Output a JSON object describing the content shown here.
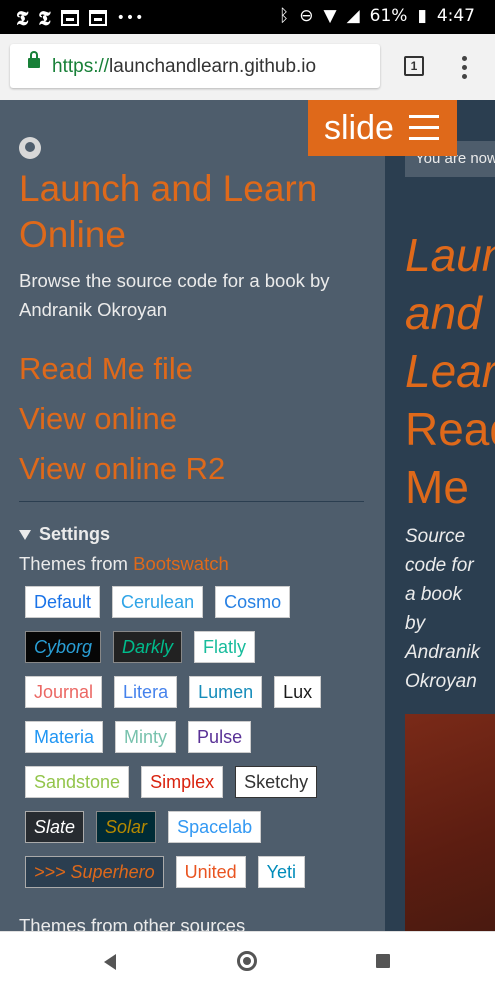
{
  "status_bar": {
    "battery": "61%",
    "time": "4:47"
  },
  "browser": {
    "url_scheme": "https://",
    "url_host": "launchandlearn.github.io",
    "tab_count": "1"
  },
  "slide_button": {
    "label": "slide"
  },
  "sidebar": {
    "title": "Launch and Learn Online",
    "description": "Browse the source code for a book by Andranik Okroyan",
    "links": [
      "Read Me file",
      "View online",
      "View online R2"
    ],
    "settings_label": "Settings",
    "themes_label": "Themes from",
    "themes_link": "Bootswatch",
    "themes": [
      [
        {
          "label": "Default",
          "fg": "#1a73e8",
          "bg": "#ffffff",
          "border": "#cccccc",
          "italic": false
        },
        {
          "label": "Cerulean",
          "fg": "#2fa4e7",
          "bg": "#ffffff",
          "border": "#cccccc",
          "italic": false
        },
        {
          "label": "Cosmo",
          "fg": "#2780e3",
          "bg": "#ffffff",
          "border": "#cccccc",
          "italic": false
        }
      ],
      [
        {
          "label": "Cyborg",
          "fg": "#2a9fd6",
          "bg": "#060606",
          "border": "#888888",
          "italic": true
        },
        {
          "label": "Darkly",
          "fg": "#00bc8c",
          "bg": "#222222",
          "border": "#888888",
          "italic": true
        },
        {
          "label": "Flatly",
          "fg": "#18bc9c",
          "bg": "#ffffff",
          "border": "#cccccc",
          "italic": false
        }
      ],
      [
        {
          "label": "Journal",
          "fg": "#eb6864",
          "bg": "#ffffff",
          "border": "#cccccc",
          "italic": false
        },
        {
          "label": "Litera",
          "fg": "#4582ec",
          "bg": "#ffffff",
          "border": "#cccccc",
          "italic": false
        },
        {
          "label": "Lumen",
          "fg": "#158cba",
          "bg": "#ffffff",
          "border": "#cccccc",
          "italic": false
        },
        {
          "label": "Lux",
          "fg": "#1a1a1a",
          "bg": "#ffffff",
          "border": "#cccccc",
          "italic": false
        }
      ],
      [
        {
          "label": "Materia",
          "fg": "#2196f3",
          "bg": "#ffffff",
          "border": "#cccccc",
          "italic": false
        },
        {
          "label": "Minty",
          "fg": "#78c2ad",
          "bg": "#ffffff",
          "border": "#cccccc",
          "italic": false
        },
        {
          "label": "Pulse",
          "fg": "#593196",
          "bg": "#ffffff",
          "border": "#cccccc",
          "italic": false
        }
      ],
      [
        {
          "label": "Sandstone",
          "fg": "#93c54b",
          "bg": "#ffffff",
          "border": "#cccccc",
          "italic": false
        },
        {
          "label": "Simplex",
          "fg": "#d9230f",
          "bg": "#ffffff",
          "border": "#cccccc",
          "italic": false
        },
        {
          "label": "Sketchy",
          "fg": "#333333",
          "bg": "#ffffff",
          "border": "#333333",
          "italic": false
        }
      ],
      [
        {
          "label": "Slate",
          "fg": "#ffffff",
          "bg": "#272b30",
          "border": "#aaaaaa",
          "italic": true
        },
        {
          "label": "Solar",
          "fg": "#b58900",
          "bg": "#002b36",
          "border": "#888888",
          "italic": true
        },
        {
          "label": "Spacelab",
          "fg": "#3399f3",
          "bg": "#ffffff",
          "border": "#cccccc",
          "italic": false
        }
      ],
      [
        {
          "label": ">>> Superhero",
          "fg": "#df691a",
          "bg": "#2b3e50",
          "border": "#aaaaaa",
          "italic": true
        },
        {
          "label": "United",
          "fg": "#e95420",
          "bg": "#ffffff",
          "border": "#cccccc",
          "italic": false
        },
        {
          "label": "Yeti",
          "fg": "#008cba",
          "bg": "#ffffff",
          "border": "#cccccc",
          "italic": false
        }
      ]
    ],
    "other_themes_label": "Themes from other sources"
  },
  "main": {
    "notice": "You are now",
    "title_italic_lines": [
      "Laun",
      "and",
      "Lear"
    ],
    "title_lines": [
      "Read",
      "Me"
    ],
    "subtitle_lines": [
      "Source",
      "code for",
      "a book",
      "by",
      "Andranik",
      "Okroyan"
    ]
  },
  "colors": {
    "accent": "#df691a",
    "sidebar_bg": "#4e5d6c",
    "main_bg": "#2b3e50"
  }
}
